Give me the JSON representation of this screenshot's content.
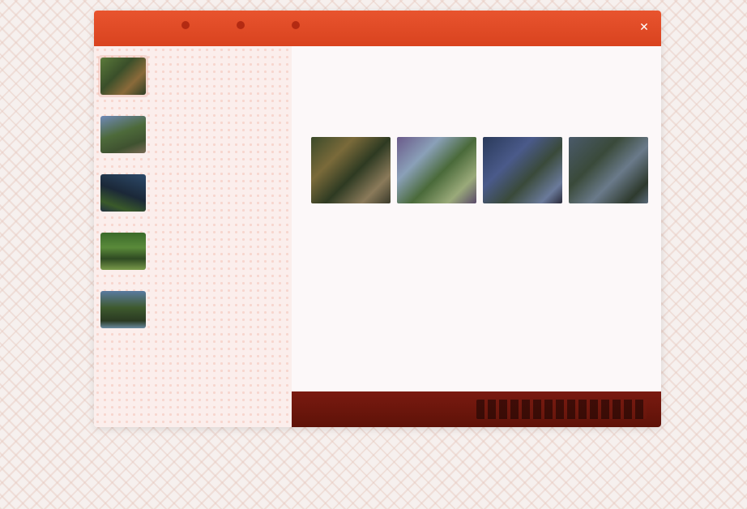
{
  "window": {
    "title": "",
    "accent_color": "#e04a26",
    "close_icon": "close-icon"
  },
  "sidebar": {
    "items": [
      {
        "name": "",
        "line1": "",
        "line2": "",
        "selected": true
      },
      {
        "name": "",
        "line1": "",
        "line2": "",
        "selected": false
      },
      {
        "name": "",
        "line1": "",
        "line2": "",
        "selected": false
      },
      {
        "name": "",
        "line1": "",
        "line2": "",
        "selected": false
      },
      {
        "name": "",
        "line1": "",
        "line2": "",
        "selected": false
      }
    ]
  },
  "detail": {
    "title": "",
    "subtitle": "",
    "info": "",
    "description": ""
  },
  "footer": {
    "button_label": ""
  }
}
